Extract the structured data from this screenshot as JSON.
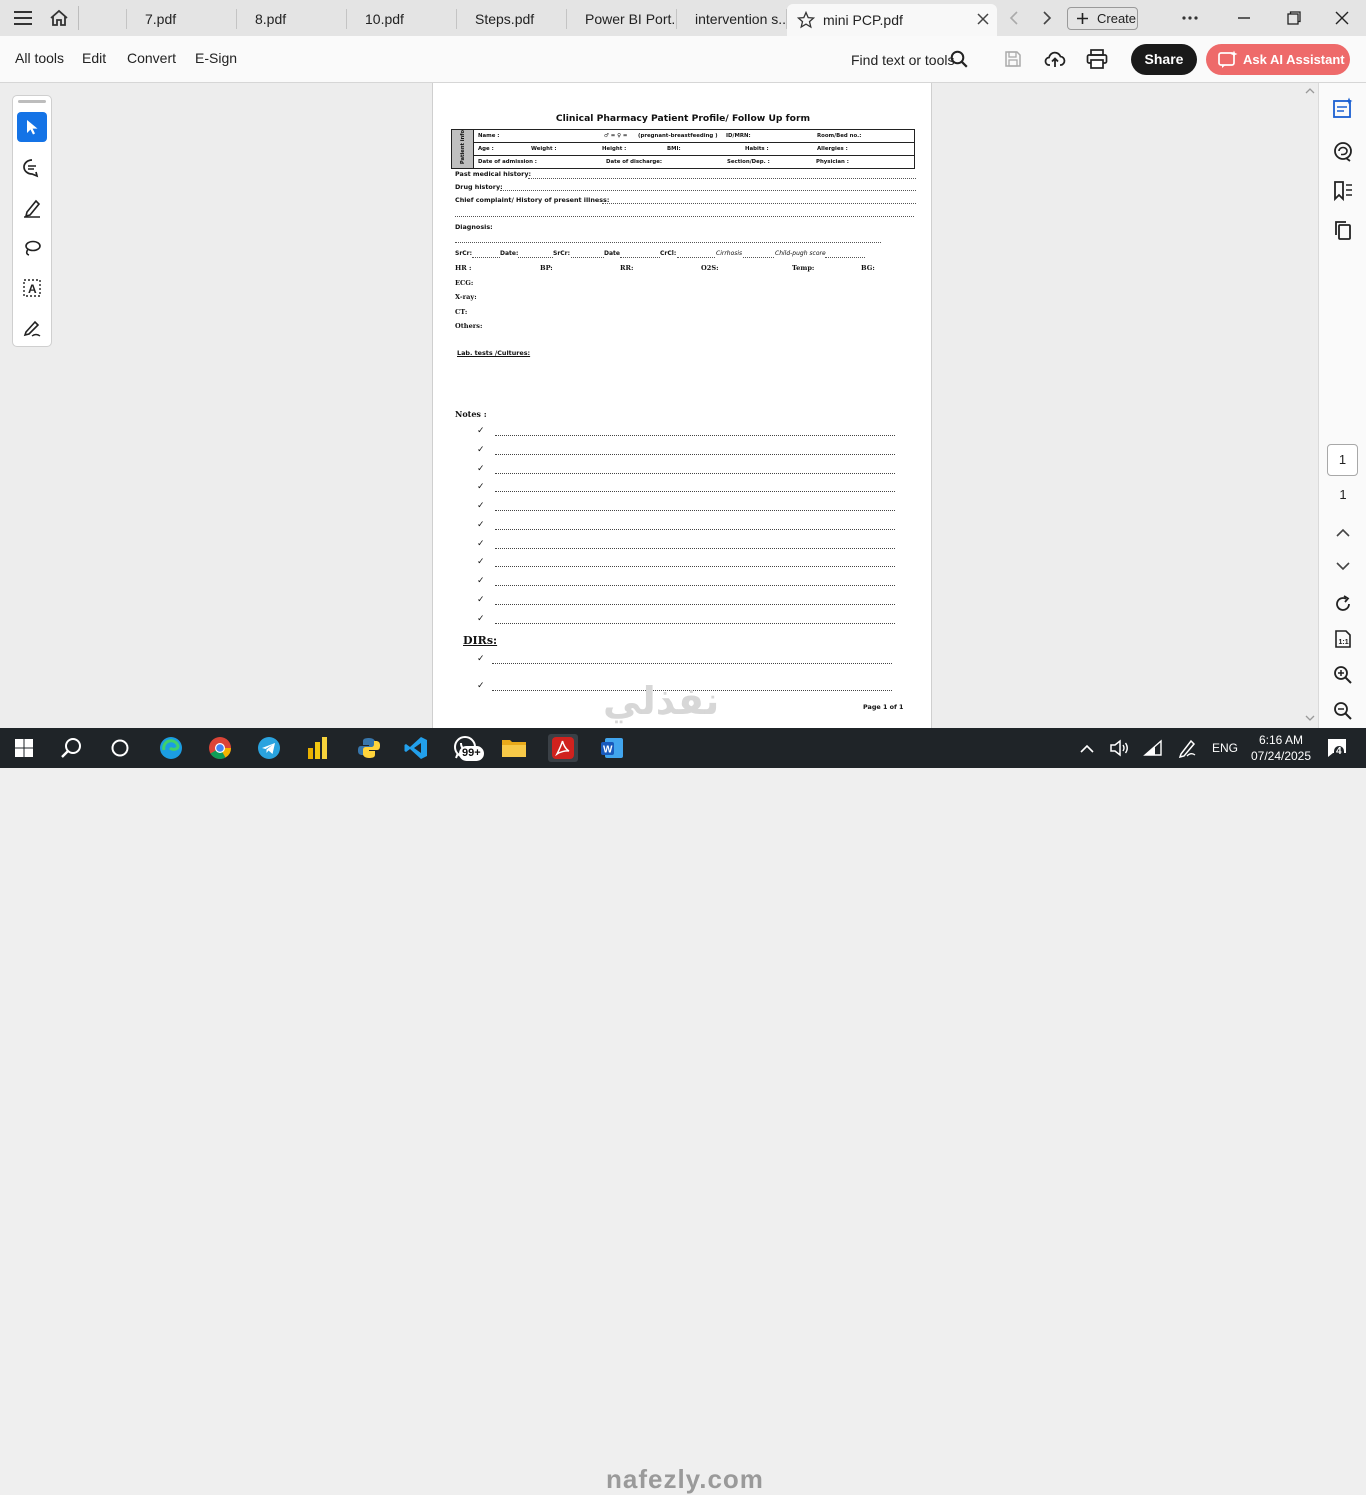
{
  "tabs": [
    {
      "label": ""
    },
    {
      "label": "7.pdf"
    },
    {
      "label": "8.pdf"
    },
    {
      "label": "10.pdf"
    },
    {
      "label": "Steps.pdf"
    },
    {
      "label": "Power BI Port..."
    },
    {
      "label": "intervention s..."
    },
    {
      "label": "mini PCP.pdf",
      "active": true
    }
  ],
  "titlebar": {
    "create_label": "Create"
  },
  "toolbar": {
    "all_tools": "All tools",
    "edit": "Edit",
    "convert": "Convert",
    "esign": "E-Sign",
    "find_text": "Find text or tools",
    "share": "Share",
    "ai_assistant": "Ask AI Assistant"
  },
  "document": {
    "title": "Clinical Pharmacy Patient Profile/ Follow Up form",
    "info_label": "Patient info",
    "row1": {
      "name": "Name :",
      "sex": "♂ =   ♀ =",
      "pregnant": "(pregnant-breastfeeding )",
      "id": "ID/MRN:",
      "room": "Room/Bed no.:"
    },
    "row2": {
      "age": "Age :",
      "weight": "Weight :",
      "height": "Height :",
      "bmi": "BMI:",
      "habits": "Habits :",
      "allergies": "Allergies :"
    },
    "row3": {
      "admission": "Date of admission :",
      "discharge": "Date of discharge:",
      "section": "Section/Dep. :",
      "physician": "Physician :"
    },
    "past_history": "Past medical history:",
    "drug_history": "Drug history:",
    "chief_complaint": "Chief complaint/ History of present illness:",
    "diagnosis": "Diagnosis:",
    "scr_line": {
      "scr1": "SrCr:",
      "date1": "Date:",
      "scr2": "SrCr:",
      "date2": "Date",
      "crcl": "CrCl:",
      "cirrhosis": "Cirrhosis",
      "child_pugh": "Child-pugh score"
    },
    "vitals": {
      "hr": "HR :",
      "bp": "BP:",
      "rr": "RR:",
      "o2s": "O2S:",
      "temp": "Temp:",
      "bg": "BG:"
    },
    "ecg": "ECG:",
    "xray": "X-ray:",
    "ct": "CT:",
    "others": "Others:",
    "lab_tests": "Lab. tests /Cultures:",
    "notes": "Notes :",
    "check": "✓",
    "dirs": "DIRs:",
    "page_footer": "Page 1 of 1",
    "watermark": "نفذلي"
  },
  "page_nav": {
    "current": "1",
    "total": "1"
  },
  "taskbar": {
    "lang": "ENG",
    "time": "6:16 AM",
    "date": "07/24/2025",
    "whatsapp_badge": "99+",
    "notif_count": "4",
    "watermark": "nafezly.com"
  }
}
